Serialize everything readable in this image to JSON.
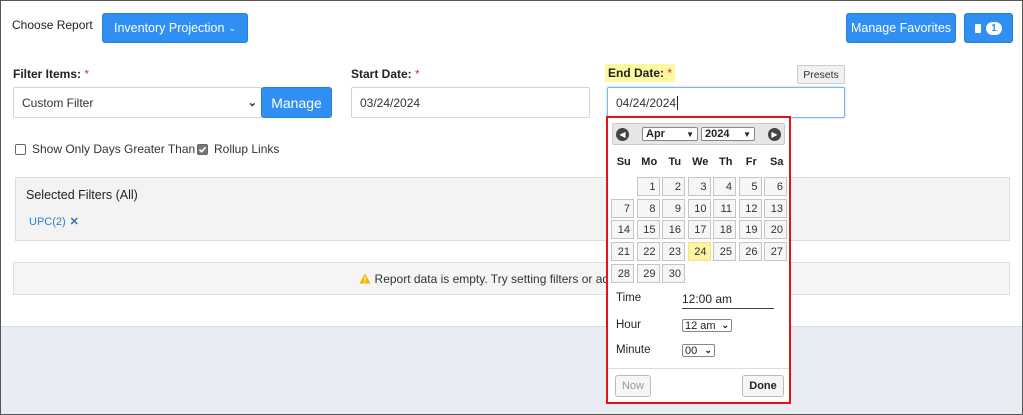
{
  "header": {
    "choose_report_label": "Choose Report",
    "report_dropdown_label": "Inventory Projection",
    "manage_favorites_label": "Manage Favorites",
    "favorites_count": "1"
  },
  "filters": {
    "filter_items_label": "Filter Items:",
    "filter_items_value": "Custom Filter",
    "manage_label": "Manage",
    "start_date_label": "Start Date:",
    "start_date_value": "03/24/2024",
    "end_date_label": "End Date:",
    "end_date_value": "04/24/2024",
    "presets_label": "Presets",
    "required_mark": "*",
    "show_only_days_label": "Show Only Days Greater Than",
    "rollup_links_label": "Rollup Links"
  },
  "selected_filters": {
    "title": "Selected Filters (All)",
    "chip_label": "UPC(2)"
  },
  "empty_message": "Report data is empty. Try setting filters or adjust the da",
  "calendar": {
    "month": "Apr",
    "year": "2024",
    "weekdays": [
      "Su",
      "Mo",
      "Tu",
      "We",
      "Th",
      "Fr",
      "Sa"
    ],
    "days": [
      "",
      "1",
      "2",
      "3",
      "4",
      "5",
      "6",
      "7",
      "8",
      "9",
      "10",
      "11",
      "12",
      "13",
      "14",
      "15",
      "16",
      "17",
      "18",
      "19",
      "20",
      "21",
      "22",
      "23",
      "24",
      "25",
      "26",
      "27",
      "28",
      "29",
      "30"
    ],
    "today": "24",
    "time_label": "Time",
    "time_value": "12:00 am",
    "hour_label": "Hour",
    "hour_value": "12 am",
    "minute_label": "Minute",
    "minute_value": "00",
    "now_label": "Now",
    "done_label": "Done"
  },
  "colors": {
    "primary": "#2f8ff3",
    "highlight": "#fbf9a0",
    "calendar_border": "#e0141b",
    "warning": "#f2b200"
  }
}
